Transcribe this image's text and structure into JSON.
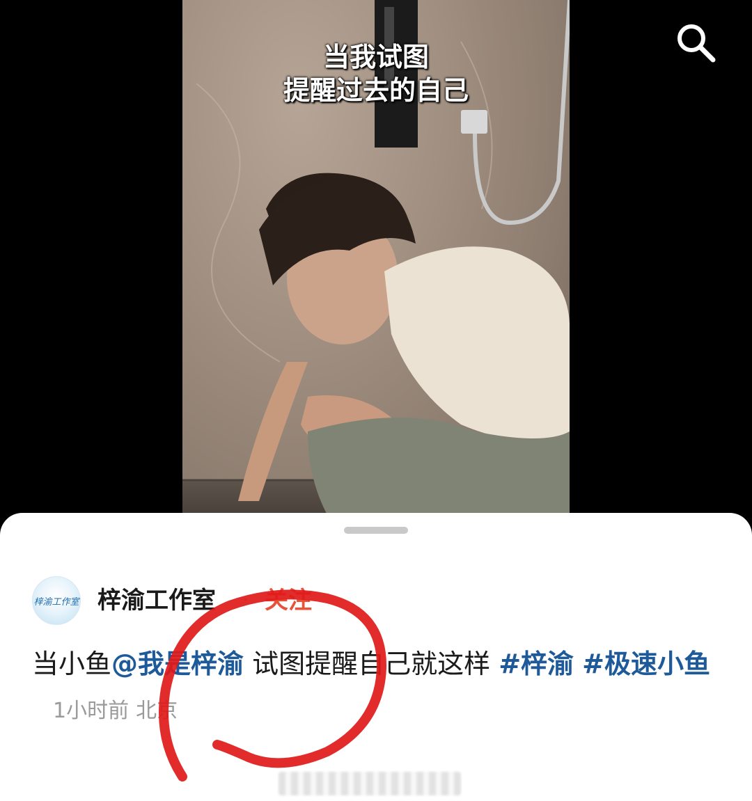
{
  "video": {
    "caption_line1": "当我试图",
    "caption_line2": "提醒过去的自己"
  },
  "header": {
    "search_icon": "search-icon"
  },
  "post": {
    "avatar_text": "梓渝工作室",
    "author": "梓渝工作室",
    "separator": "·",
    "follow_label": "关注",
    "text_prefix": "当小鱼",
    "mention": "@我是梓渝",
    "text_middle": " 试图提醒自己就这样 ",
    "hashtag1": "#梓渝",
    "hashtag2": "#极速小鱼",
    "time": "1小时前",
    "location": "北京"
  },
  "colors": {
    "link": "#1e5a9a",
    "follow": "#e8533a",
    "annotation": "#e01a1a"
  }
}
